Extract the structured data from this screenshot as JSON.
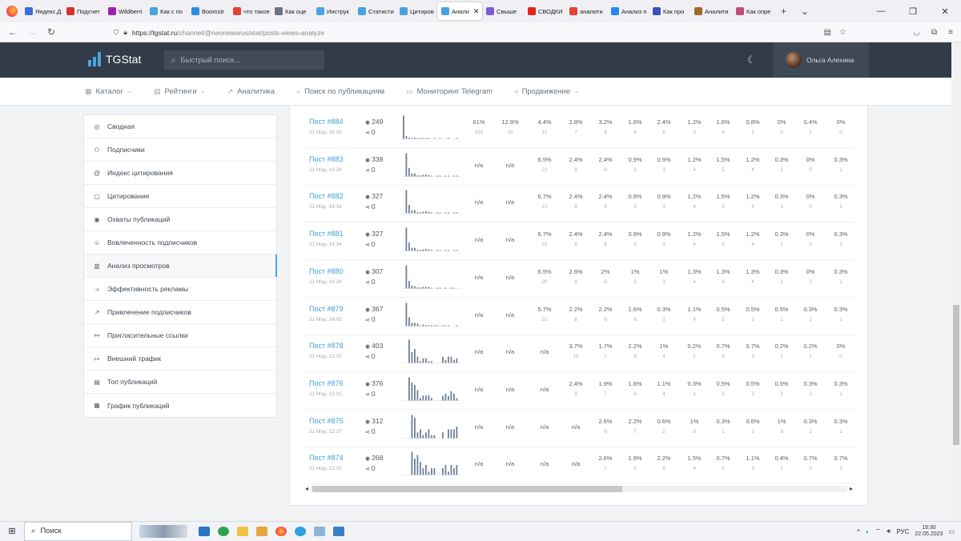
{
  "browser": {
    "tabs": [
      {
        "label": "Яндекс.Д",
        "color": "#3c6ee0"
      },
      {
        "label": "Подсчет",
        "color": "#d8322a"
      },
      {
        "label": "Wildberri",
        "color": "#9b21b3"
      },
      {
        "label": "Как с по",
        "color": "#4aa3df"
      },
      {
        "label": "Boomstr",
        "color": "#2d8de0"
      },
      {
        "label": "что такое",
        "color": "#e54130"
      },
      {
        "label": "Как оце",
        "color": "#6b7280"
      },
      {
        "label": "Инструк",
        "color": "#4aa3df"
      },
      {
        "label": "Статисти",
        "color": "#4aa3df"
      },
      {
        "label": "Цитиров",
        "color": "#4aa3df"
      },
      {
        "label": "Анали",
        "color": "#4aa3df",
        "active": true
      },
      {
        "label": "Свыше",
        "color": "#7b5cd6"
      },
      {
        "label": "СВОДКИ",
        "color": "#e62117"
      },
      {
        "label": "аналити",
        "color": "#e54130"
      },
      {
        "label": "Анализ п",
        "color": "#2787f5"
      },
      {
        "label": "Как про",
        "color": "#3f51b5"
      },
      {
        "label": "Аналити",
        "color": "#9c6b2e"
      },
      {
        "label": "Как опре",
        "color": "#c44d7a"
      }
    ],
    "url_host": "https://tgstat.ru",
    "url_path": "/channel/@neonewsrus/stat/posts-views-analyze"
  },
  "header": {
    "brand": "TGStat",
    "search_placeholder": "Быстрый поиск...",
    "user_name": "Ольга Алехина"
  },
  "menu": [
    {
      "label": "Каталог",
      "icon": "grid-icon",
      "glyph": "▦",
      "dropdown": true
    },
    {
      "label": "Рейтинги",
      "icon": "rating-icon",
      "glyph": "▤",
      "dropdown": true
    },
    {
      "label": "Аналитика",
      "icon": "chart-icon",
      "glyph": "↗",
      "dropdown": false
    },
    {
      "label": "Поиск по публикациям",
      "icon": "search-icon",
      "glyph": "⌕",
      "dropdown": false
    },
    {
      "label": "Мониторинг Telegram",
      "icon": "monitor-icon",
      "glyph": "▭",
      "dropdown": false
    },
    {
      "label": "Продвижение",
      "icon": "megaphone-icon",
      "glyph": "◃",
      "dropdown": true
    }
  ],
  "sidebar": [
    {
      "label": "Сводная",
      "icon": "summary-icon",
      "glyph": "◎"
    },
    {
      "label": "Подписчики",
      "icon": "users-icon",
      "glyph": "⚇"
    },
    {
      "label": "Индекс цитирования",
      "icon": "at-icon",
      "glyph": "@"
    },
    {
      "label": "Цитирование",
      "icon": "quote-icon",
      "glyph": "▢"
    },
    {
      "label": "Охваты публикаций",
      "icon": "eye-icon",
      "glyph": "◉"
    },
    {
      "label": "Вовлеченность подписчиков",
      "icon": "engagement-icon",
      "glyph": "☺"
    },
    {
      "label": "Анализ просмотров",
      "icon": "bar-chart-icon",
      "glyph": "▥",
      "active": true
    },
    {
      "label": "Эффективность рекламы",
      "icon": "ads-icon",
      "glyph": "◃"
    },
    {
      "label": "Привлечение подписчиков",
      "icon": "trend-icon",
      "glyph": "↗"
    },
    {
      "label": "Пригласительные ссылки",
      "icon": "link-icon",
      "glyph": "⚯"
    },
    {
      "label": "Внешний трафик",
      "icon": "arrow-icon",
      "glyph": "↦"
    },
    {
      "label": "Топ публикаций",
      "icon": "top-icon",
      "glyph": "▤"
    },
    {
      "label": "График публикаций",
      "icon": "calendar-icon",
      "glyph": "▦"
    }
  ],
  "posts": [
    {
      "title": "Пост #884",
      "date": "21 May, 16:00",
      "views": "249",
      "shares": "0",
      "cells": [
        [
          "61%",
          "152"
        ],
        [
          "12.9%",
          "32"
        ],
        [
          "4.4%",
          "11"
        ],
        [
          "2.8%",
          "7"
        ],
        [
          "3.2%",
          "8"
        ],
        [
          "1.6%",
          "4"
        ],
        [
          "2.4%",
          "6"
        ],
        [
          "1.2%",
          "3"
        ],
        [
          "1.6%",
          "4"
        ],
        [
          "0.8%",
          "2"
        ],
        [
          "0%",
          "0"
        ],
        [
          "0.4%",
          "1"
        ],
        [
          "0%",
          "0"
        ]
      ],
      "spark": [
        1,
        0.12,
        0.05,
        0.04,
        0.05,
        0.03,
        0.03,
        0.02,
        0.02,
        0.01,
        0,
        0.01,
        0,
        0.01,
        0,
        0,
        0.01,
        0,
        0,
        0.01
      ]
    },
    {
      "title": "Пост #883",
      "date": "21 May, 14:34",
      "views": "338",
      "shares": "0",
      "cells": [
        [
          "n/a",
          ""
        ],
        [
          "n/a",
          ""
        ],
        [
          "6.5%",
          "22"
        ],
        [
          "2.4%",
          "8"
        ],
        [
          "2.4%",
          "8"
        ],
        [
          "0.9%",
          "3"
        ],
        [
          "0.9%",
          "3"
        ],
        [
          "1.2%",
          "4"
        ],
        [
          "1.5%",
          "5"
        ],
        [
          "1.2%",
          "4"
        ],
        [
          "0.3%",
          "1"
        ],
        [
          "0%",
          "0"
        ],
        [
          "0.3%",
          "1"
        ]
      ],
      "spark": [
        0,
        1,
        0.36,
        0.13,
        0.13,
        0.05,
        0.05,
        0.07,
        0.08,
        0.07,
        0.02,
        0,
        0.02,
        0.02,
        0,
        0.02,
        0.02,
        0,
        0.02,
        0.02
      ]
    },
    {
      "title": "Пост #882",
      "date": "21 May, 14:34",
      "views": "327",
      "shares": "0",
      "cells": [
        [
          "n/a",
          ""
        ],
        [
          "n/a",
          ""
        ],
        [
          "6.7%",
          "22"
        ],
        [
          "2.4%",
          "8"
        ],
        [
          "2.4%",
          "8"
        ],
        [
          "0.9%",
          "3"
        ],
        [
          "0.9%",
          "3"
        ],
        [
          "1.2%",
          "4"
        ],
        [
          "1.5%",
          "5"
        ],
        [
          "1.2%",
          "4"
        ],
        [
          "0.3%",
          "1"
        ],
        [
          "0%",
          "0"
        ],
        [
          "0.3%",
          "1"
        ]
      ],
      "spark": [
        0,
        1,
        0.36,
        0.13,
        0.13,
        0.05,
        0.05,
        0.07,
        0.08,
        0.07,
        0.02,
        0,
        0.02,
        0.02,
        0,
        0.02,
        0.02,
        0,
        0.02,
        0.02
      ]
    },
    {
      "title": "Пост #881",
      "date": "21 May, 14:34",
      "views": "327",
      "shares": "0",
      "cells": [
        [
          "n/a",
          ""
        ],
        [
          "n/a",
          ""
        ],
        [
          "6.7%",
          "22"
        ],
        [
          "2.4%",
          "8"
        ],
        [
          "2.4%",
          "8"
        ],
        [
          "0.9%",
          "3"
        ],
        [
          "0.9%",
          "3"
        ],
        [
          "1.2%",
          "4"
        ],
        [
          "1.5%",
          "5"
        ],
        [
          "1.2%",
          "4"
        ],
        [
          "0.3%",
          "1"
        ],
        [
          "0%",
          "0"
        ],
        [
          "0.3%",
          "1"
        ]
      ],
      "spark": [
        0,
        1,
        0.36,
        0.13,
        0.13,
        0.05,
        0.05,
        0.07,
        0.08,
        0.07,
        0.02,
        0,
        0.02,
        0.02,
        0,
        0.02,
        0.02,
        0,
        0.02,
        0.02
      ]
    },
    {
      "title": "Пост #880",
      "date": "21 May, 14:34",
      "views": "307",
      "shares": "0",
      "cells": [
        [
          "n/a",
          ""
        ],
        [
          "n/a",
          ""
        ],
        [
          "6.5%",
          "20"
        ],
        [
          "2.6%",
          "8"
        ],
        [
          "2%",
          "6"
        ],
        [
          "1%",
          "3"
        ],
        [
          "1%",
          "3"
        ],
        [
          "1.3%",
          "4"
        ],
        [
          "1.3%",
          "4"
        ],
        [
          "1.3%",
          "4"
        ],
        [
          "0.3%",
          "1"
        ],
        [
          "0%",
          "0"
        ],
        [
          "0.3%",
          "1"
        ]
      ],
      "spark": [
        0,
        1,
        0.33,
        0.13,
        0.1,
        0.05,
        0.05,
        0.07,
        0.07,
        0.07,
        0.02,
        0,
        0.02,
        0.02,
        0,
        0.02,
        0,
        0.02,
        0.02,
        0
      ]
    },
    {
      "title": "Пост #879",
      "date": "21 May, 14:05",
      "views": "367",
      "shares": "0",
      "cells": [
        [
          "n/a",
          ""
        ],
        [
          "n/a",
          ""
        ],
        [
          "5.7%",
          "21"
        ],
        [
          "2.2%",
          "8"
        ],
        [
          "2.2%",
          "8"
        ],
        [
          "1.6%",
          "6"
        ],
        [
          "0.3%",
          "1"
        ],
        [
          "1.1%",
          "4"
        ],
        [
          "0.5%",
          "2"
        ],
        [
          "0.5%",
          "2"
        ],
        [
          "0.5%",
          "2"
        ],
        [
          "0.3%",
          "1"
        ],
        [
          "0.3%",
          "1"
        ]
      ],
      "spark": [
        0,
        1,
        0.38,
        0.14,
        0.14,
        0.11,
        0.02,
        0.07,
        0.04,
        0.04,
        0.04,
        0.02,
        0.02,
        0,
        0.02,
        0.02,
        0.02,
        0,
        0,
        0.02
      ]
    },
    {
      "title": "Пост #878",
      "date": "21 May, 13:37",
      "views": "403",
      "shares": "0",
      "cells": [
        [
          "n/a",
          ""
        ],
        [
          "n/a",
          ""
        ],
        [
          "n/a",
          ""
        ],
        [
          "3.7%",
          "15"
        ],
        [
          "1.7%",
          "7"
        ],
        [
          "2.2%",
          "9"
        ],
        [
          "1%",
          "4"
        ],
        [
          "0.2%",
          "1"
        ],
        [
          "0.7%",
          "3"
        ],
        [
          "0.7%",
          "3"
        ],
        [
          "0.2%",
          "1"
        ],
        [
          "0.2%",
          "1"
        ],
        [
          "0%",
          "0"
        ]
      ],
      "spark": [
        0,
        0,
        1,
        0.47,
        0.6,
        0.27,
        0.07,
        0.2,
        0.2,
        0.07,
        0.07,
        0,
        0,
        0,
        0.27,
        0.13,
        0.27,
        0.27,
        0.13,
        0.2
      ]
    },
    {
      "title": "Пост #876",
      "date": "21 May, 13:01",
      "views": "376",
      "shares": "0",
      "cells": [
        [
          "n/a",
          ""
        ],
        [
          "n/a",
          ""
        ],
        [
          "n/a",
          ""
        ],
        [
          "2.4%",
          "9"
        ],
        [
          "1.9%",
          "7"
        ],
        [
          "1.6%",
          "6"
        ],
        [
          "1.1%",
          "4"
        ],
        [
          "0.3%",
          "1"
        ],
        [
          "0.5%",
          "2"
        ],
        [
          "0.5%",
          "2"
        ],
        [
          "0.5%",
          "2"
        ],
        [
          "0.3%",
          "1"
        ],
        [
          "0.3%",
          "1"
        ]
      ],
      "spark": [
        0,
        0,
        1,
        0.78,
        0.67,
        0.44,
        0.11,
        0.22,
        0.22,
        0.22,
        0.11,
        0,
        0,
        0,
        0.2,
        0.3,
        0.2,
        0.4,
        0.3,
        0.1
      ]
    },
    {
      "title": "Пост #875",
      "date": "21 May, 12:37",
      "views": "312",
      "shares": "0",
      "cells": [
        [
          "n/a",
          ""
        ],
        [
          "n/a",
          ""
        ],
        [
          "n/a",
          ""
        ],
        [
          "n/a",
          ""
        ],
        [
          "2.6%",
          "8"
        ],
        [
          "2.2%",
          "7"
        ],
        [
          "0.6%",
          "2"
        ],
        [
          "1%",
          "3"
        ],
        [
          "0.3%",
          "1"
        ],
        [
          "0.6%",
          "2"
        ],
        [
          "1%",
          "3"
        ],
        [
          "0.3%",
          "1"
        ],
        [
          "0.3%",
          "1"
        ]
      ],
      "spark": [
        0,
        0,
        0,
        1,
        0.88,
        0.25,
        0.38,
        0.13,
        0.25,
        0.38,
        0.13,
        0.13,
        0,
        0,
        0.25,
        0,
        0.38,
        0.38,
        0.38,
        0.5
      ]
    },
    {
      "title": "Пост #874",
      "date": "21 May, 12:02",
      "views": "268",
      "shares": "0",
      "cells": [
        [
          "n/a",
          ""
        ],
        [
          "n/a",
          ""
        ],
        [
          "n/a",
          ""
        ],
        [
          "n/a",
          ""
        ],
        [
          "2.6%",
          "7"
        ],
        [
          "1.9%",
          "5"
        ],
        [
          "2.2%",
          "6"
        ],
        [
          "1.5%",
          "4"
        ],
        [
          "0.7%",
          "2"
        ],
        [
          "1.1%",
          "3"
        ],
        [
          "0.4%",
          "1"
        ],
        [
          "0.7%",
          "2"
        ],
        [
          "0.7%",
          "2"
        ]
      ],
      "spark": [
        0,
        0,
        0,
        1,
        0.71,
        0.86,
        0.57,
        0.29,
        0.43,
        0.14,
        0.29,
        0.29,
        0,
        0,
        0.29,
        0.43,
        0.14,
        0.43,
        0.29,
        0.43
      ]
    }
  ],
  "taskbar": {
    "search_label": "Поиск",
    "lang": "РУС",
    "time": "19:30",
    "date": "22.05.2023"
  },
  "colors": {
    "header_bg": "#323c48",
    "accent": "#43a6df",
    "spark_bar": "#6f7e96"
  }
}
